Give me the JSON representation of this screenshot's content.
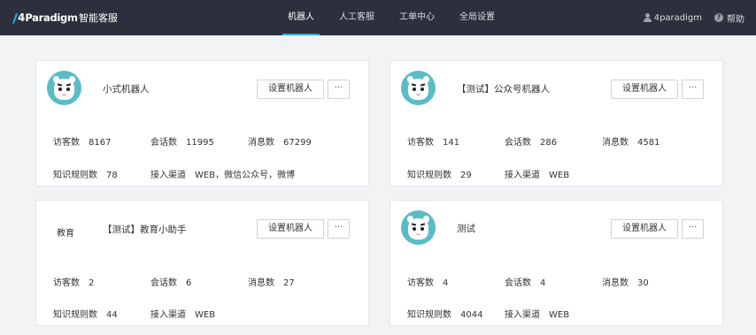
{
  "header": {
    "brand_digit": "4",
    "brand_word": "Paradigm",
    "product": "智能客服",
    "nav": [
      {
        "label": "机器人",
        "active": true
      },
      {
        "label": "人工客服",
        "active": false
      },
      {
        "label": "工单中心",
        "active": false
      },
      {
        "label": "全局设置",
        "active": false
      }
    ],
    "user": "4paradigm",
    "help": "帮助",
    "help_glyph": "?"
  },
  "labels": {
    "visitors": "访客数",
    "sessions": "会话数",
    "messages": "消息数",
    "rules": "知识规则数",
    "channels": "接入渠道",
    "settings_button": "设置机器人",
    "more_button": "···"
  },
  "bots": [
    {
      "name": "小式机器人",
      "avatar": "robot",
      "avatar_text": "",
      "visitors": "8167",
      "sessions": "11995",
      "messages": "67299",
      "rules": "78",
      "channels": "WEB，微信公众号，微博"
    },
    {
      "name": "【测试】公众号机器人",
      "avatar": "robot",
      "avatar_text": "",
      "visitors": "141",
      "sessions": "286",
      "messages": "4581",
      "rules": "29",
      "channels": "WEB"
    },
    {
      "name": "【测试】教育小助手",
      "avatar": "text",
      "avatar_text": "教育",
      "visitors": "2",
      "sessions": "6",
      "messages": "27",
      "rules": "44",
      "channels": "WEB"
    },
    {
      "name": "测试",
      "avatar": "robot",
      "avatar_text": "",
      "visitors": "4",
      "sessions": "4",
      "messages": "30",
      "rules": "4044",
      "channels": "WEB"
    }
  ],
  "colors": {
    "topbar": "#2b303c",
    "accent": "#2fa7e0",
    "avatar_bg": "#5bbcc6"
  }
}
